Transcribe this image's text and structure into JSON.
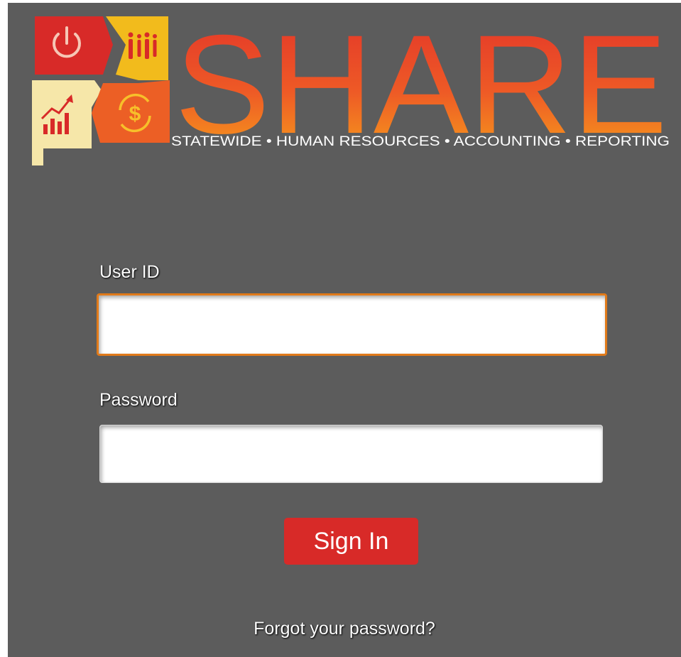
{
  "logo": {
    "wordmark": "SHARE",
    "tagline": "STATEWIDE • HUMAN RESOURCES • ACCOUNTING • REPORTING",
    "icons": [
      "power-icon",
      "people-icon",
      "growth-chart-icon",
      "dollar-cycle-icon"
    ],
    "colors": {
      "red": "#d82a28",
      "yellow": "#f2bb1c",
      "orange": "#ec5f25",
      "cream": "#f6e7a9"
    }
  },
  "form": {
    "userid_label": "User ID",
    "userid_value": "",
    "password_label": "Password",
    "password_value": "",
    "signin_label": "Sign In",
    "forgot_label": "Forgot your password?"
  },
  "colors": {
    "background": "#5c5c5c",
    "button": "#d82a28",
    "focus_border": "#e07a1a"
  }
}
